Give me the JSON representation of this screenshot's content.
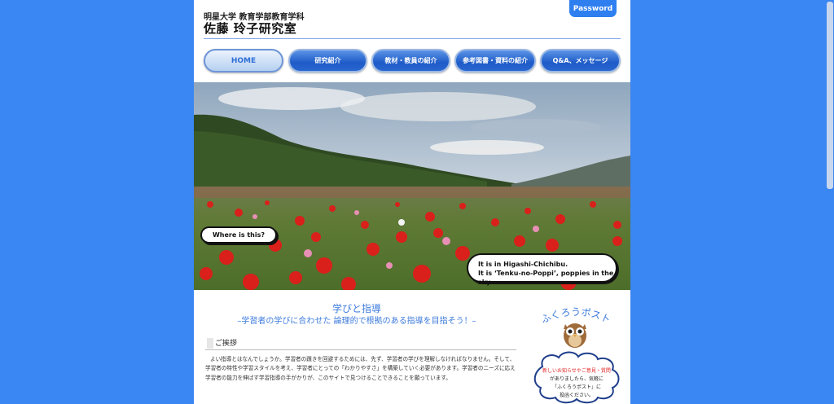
{
  "header": {
    "university": "明星大学 教育学部教育学科",
    "lab_name": "佐藤 玲子研究室",
    "password_label": "Password"
  },
  "nav": {
    "items": [
      {
        "label": "HOME"
      },
      {
        "label": "研究紹介"
      },
      {
        "label": "教材・教員の紹介"
      },
      {
        "label": "参考図書・資料の紹介"
      },
      {
        "label": "Q&A、メッセージ"
      }
    ]
  },
  "hero": {
    "question": "Where is this?",
    "answer_line1": "It is in Higashi-Chichibu.",
    "answer_line2": "It is ‘Tenku-no-Poppi’, poppies in the sky."
  },
  "main": {
    "title": "学びと指導",
    "subtitle": "–学習者の学びに合わせた 論理的で根拠のある指導を目指そう！–",
    "greeting_heading": "ご挨拶",
    "greeting_body": "よい指導とはなんでしょうか。学習者の躓きを回避するためには、先ず、学習者の学びを理解しなければなりません。そして、学習者の特性や学習スタイルを考え、学習者にとっての「わかりやすさ」を構築していく必要があります。学習者のニーズに応え学習者の能力を伸ばす学習指導の手がかりが、このサイトで見つけることできることを願っています。"
  },
  "sidebar": {
    "title": "ふくろうポスト",
    "notice_red": "新しいお知らせやご意見・質問",
    "notice_line2": "がありましたら、気軽に",
    "notice_line3": "「ふくろうポスト」に",
    "notice_line4": "投函ください。"
  },
  "colors": {
    "background": "#3a86f2",
    "accent": "#2f7ff0",
    "title_blue": "#3d7bdc"
  }
}
